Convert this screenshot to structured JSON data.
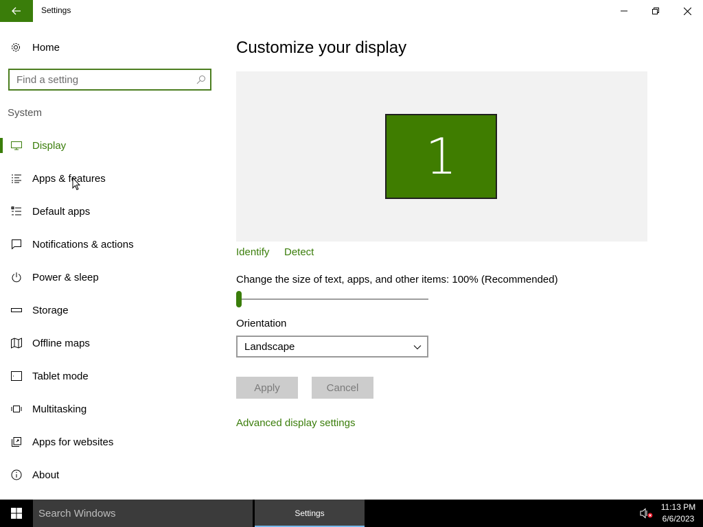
{
  "window": {
    "title": "Settings",
    "controls": [
      "minimize",
      "restore",
      "close"
    ]
  },
  "sidebar": {
    "home_label": "Home",
    "search_placeholder": "Find a setting",
    "section": "System",
    "items": [
      {
        "label": "Display",
        "icon": "monitor-icon",
        "active": true
      },
      {
        "label": "Apps & features",
        "icon": "list-icon"
      },
      {
        "label": "Default apps",
        "icon": "default-apps-icon"
      },
      {
        "label": "Notifications & actions",
        "icon": "notification-icon"
      },
      {
        "label": "Power & sleep",
        "icon": "power-icon"
      },
      {
        "label": "Storage",
        "icon": "storage-icon"
      },
      {
        "label": "Offline maps",
        "icon": "map-icon"
      },
      {
        "label": "Tablet mode",
        "icon": "tablet-icon"
      },
      {
        "label": "Multitasking",
        "icon": "multitasking-icon"
      },
      {
        "label": "Apps for websites",
        "icon": "web-apps-icon"
      },
      {
        "label": "About",
        "icon": "info-icon"
      }
    ]
  },
  "main": {
    "title": "Customize your display",
    "monitor_number": "1",
    "identify_label": "Identify",
    "detect_label": "Detect",
    "scale_label": "Change the size of text, apps, and other items: 100% (Recommended)",
    "scale_value_fraction": 0,
    "orientation_label": "Orientation",
    "orientation_value": "Landscape",
    "apply_label": "Apply",
    "cancel_label": "Cancel",
    "advanced_label": "Advanced display settings"
  },
  "taskbar": {
    "search_text": "Search Windows",
    "active_app": "Settings",
    "time": "11:13 PM",
    "date": "6/6/2023"
  },
  "colors": {
    "accent": "#3a7d0a",
    "monitor": "#3f7d00",
    "taskbar": "#000000"
  }
}
